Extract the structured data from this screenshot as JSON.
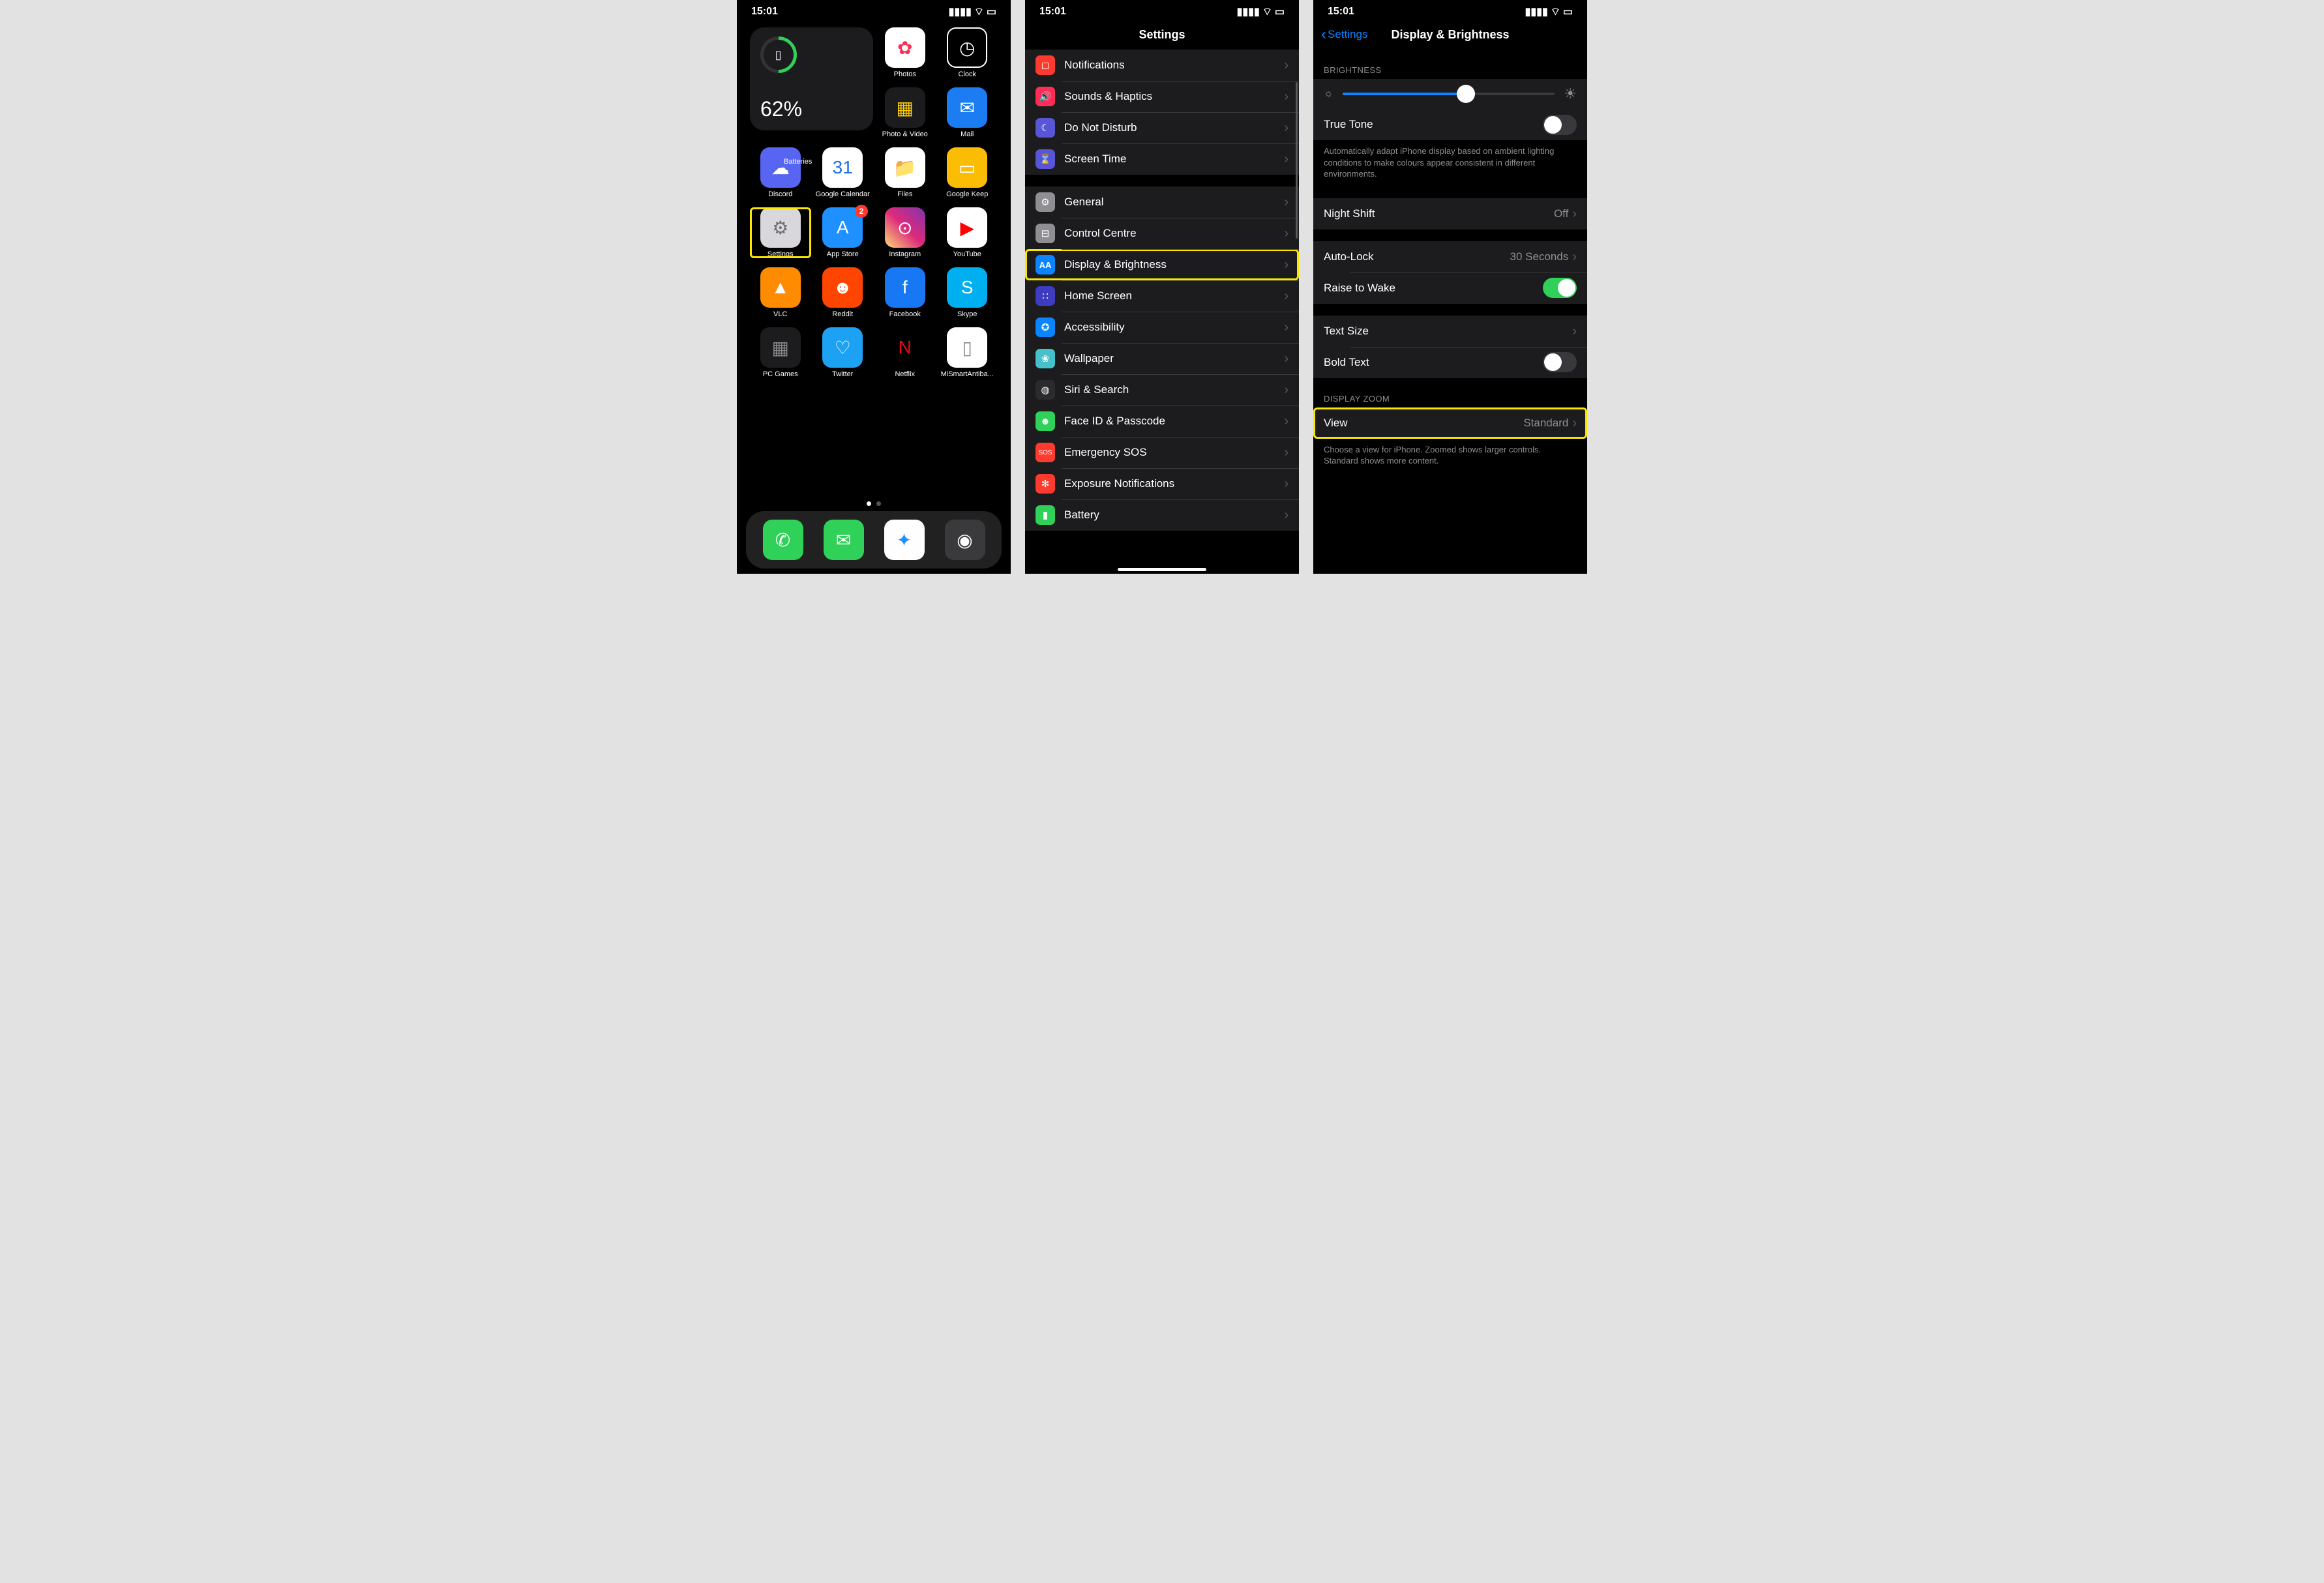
{
  "status": {
    "time": "15:01"
  },
  "home": {
    "widget": {
      "label": "Batteries",
      "pct": "62%"
    },
    "apps": [
      {
        "label": "Photos",
        "bg": "#fff",
        "glyph": "✿",
        "fg": "#ff2d55"
      },
      {
        "label": "Clock",
        "bg": "#000",
        "glyph": "◷",
        "fg": "#fff",
        "border": "#fff"
      },
      {
        "label": "Photo & Video",
        "bg": "#1c1c1e",
        "glyph": "▦",
        "fg": "#ffcc00"
      },
      {
        "label": "Mail",
        "bg": "#1c7cf2",
        "glyph": "✉",
        "fg": "#fff"
      },
      {
        "label": "Discord",
        "bg": "#5865f2",
        "glyph": "☁",
        "fg": "#fff"
      },
      {
        "label": "Google Calendar",
        "bg": "#fff",
        "glyph": "31",
        "fg": "#1a73e8"
      },
      {
        "label": "Files",
        "bg": "#fff",
        "glyph": "📁",
        "fg": "#1aa1f1"
      },
      {
        "label": "Google Keep",
        "bg": "#fbbc04",
        "glyph": "▭",
        "fg": "#fff"
      },
      {
        "label": "Settings",
        "bg": "#d8d8dc",
        "glyph": "⚙",
        "fg": "#6f6f73",
        "hl": true
      },
      {
        "label": "App Store",
        "bg": "#1e90ff",
        "glyph": "A",
        "fg": "#fff",
        "badge": "2"
      },
      {
        "label": "Instagram",
        "bg": "linear-gradient(45deg,#feda77,#dd2a7b,#8134af)",
        "glyph": "⊙",
        "fg": "#fff"
      },
      {
        "label": "YouTube",
        "bg": "#fff",
        "glyph": "▶",
        "fg": "#ff0000"
      },
      {
        "label": "VLC",
        "bg": "#ff8c00",
        "glyph": "▲",
        "fg": "#fff"
      },
      {
        "label": "Reddit",
        "bg": "#ff4500",
        "glyph": "☻",
        "fg": "#fff"
      },
      {
        "label": "Facebook",
        "bg": "#1877f2",
        "glyph": "f",
        "fg": "#fff"
      },
      {
        "label": "Skype",
        "bg": "#00aff0",
        "glyph": "S",
        "fg": "#fff"
      },
      {
        "label": "PC Games",
        "bg": "#1c1c1e",
        "glyph": "▦",
        "fg": "#888"
      },
      {
        "label": "Twitter",
        "bg": "#1da1f2",
        "glyph": "♡",
        "fg": "#fff"
      },
      {
        "label": "Netflix",
        "bg": "#000",
        "glyph": "N",
        "fg": "#e50914"
      },
      {
        "label": "MiSmartAntiba...",
        "bg": "#fff",
        "glyph": "▯",
        "fg": "#888"
      }
    ],
    "dock": [
      {
        "label": "Phone",
        "bg": "#30d158",
        "glyph": "✆"
      },
      {
        "label": "Messages",
        "bg": "#30d158",
        "glyph": "✉"
      },
      {
        "label": "Safari",
        "bg": "#fefefe",
        "glyph": "✦",
        "fg": "#1e90ff"
      },
      {
        "label": "Camera",
        "bg": "#3a3a3c",
        "glyph": "◉"
      }
    ]
  },
  "settings": {
    "title": "Settings",
    "rows": [
      {
        "label": "Notifications",
        "bg": "#ff3b30",
        "glyph": "◻"
      },
      {
        "label": "Sounds & Haptics",
        "bg": "#ff2d55",
        "glyph": "🔊"
      },
      {
        "label": "Do Not Disturb",
        "bg": "#5856d6",
        "glyph": "☾"
      },
      {
        "label": "Screen Time",
        "bg": "#5856d6",
        "glyph": "⌛"
      }
    ],
    "rows2": [
      {
        "label": "General",
        "bg": "#8e8e93",
        "glyph": "⚙"
      },
      {
        "label": "Control Centre",
        "bg": "#8e8e93",
        "glyph": "⊟"
      },
      {
        "label": "Display & Brightness",
        "bg": "#0a84ff",
        "glyph": "AA",
        "hl": true
      },
      {
        "label": "Home Screen",
        "bg": "#3f3cc0",
        "glyph": "∷"
      },
      {
        "label": "Accessibility",
        "bg": "#0a84ff",
        "glyph": "✪"
      },
      {
        "label": "Wallpaper",
        "bg": "#46c0c9",
        "glyph": "❀"
      },
      {
        "label": "Siri & Search",
        "bg": "#2b2b2e",
        "glyph": "◍"
      },
      {
        "label": "Face ID & Passcode",
        "bg": "#30d158",
        "glyph": "☻"
      },
      {
        "label": "Emergency SOS",
        "bg": "#ff3b30",
        "glyph": "SOS",
        "fs": "10px"
      },
      {
        "label": "Exposure Notifications",
        "bg": "#ff3b30",
        "glyph": "✻"
      },
      {
        "label": "Battery",
        "bg": "#30d158",
        "glyph": "▮"
      }
    ]
  },
  "db": {
    "back": "Settings",
    "title": "Display & Brightness",
    "brightnessHdr": "BRIGHTNESS",
    "truetone": "True Tone",
    "ttdesc": "Automatically adapt iPhone display based on ambient lighting conditions to make colours appear consistent in different environments.",
    "nightshift": {
      "label": "Night Shift",
      "value": "Off"
    },
    "autolock": {
      "label": "Auto-Lock",
      "value": "30 Seconds"
    },
    "raise": "Raise to Wake",
    "textsize": "Text Size",
    "bold": "Bold Text",
    "zoomhdr": "DISPLAY ZOOM",
    "view": {
      "label": "View",
      "value": "Standard"
    },
    "viewdesc": "Choose a view for iPhone. Zoomed shows larger controls. Standard shows more content."
  }
}
